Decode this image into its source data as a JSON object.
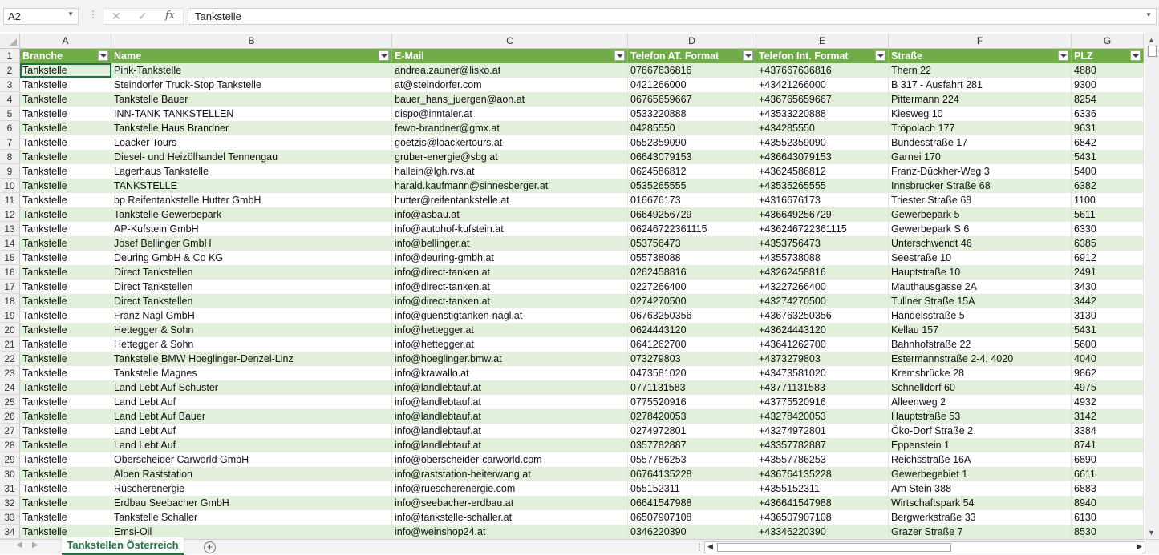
{
  "formula_bar": {
    "name_box": "A2",
    "cancel_icon": "✕",
    "enter_icon": "✓",
    "fx_label": "fx",
    "content": "Tankstelle"
  },
  "columns": [
    "A",
    "B",
    "C",
    "D",
    "E",
    "F",
    "G"
  ],
  "header_row": {
    "row_number": "1",
    "cells": [
      "Branche",
      "Name",
      "E-Mail",
      "Telefon AT. Format",
      "Telefon Int. Format",
      "Straße",
      "PLZ"
    ]
  },
  "rows": [
    {
      "n": "2",
      "cells": [
        "Tankstelle",
        "Pink-Tankstelle",
        "andrea.zauner@lisko.at",
        "07667636816",
        "+437667636816",
        "Thern 22",
        "4880"
      ]
    },
    {
      "n": "3",
      "cells": [
        "Tankstelle",
        "Steindorfer Truck-Stop Tankstelle",
        "at@steindorfer.com",
        "0421266000",
        "+43421266000",
        "B 317 - Ausfahrt 281",
        "9300"
      ]
    },
    {
      "n": "4",
      "cells": [
        "Tankstelle",
        "Tankstelle Bauer",
        "bauer_hans_juergen@aon.at",
        "06765659667",
        "+436765659667",
        "Pittermann 224",
        "8254"
      ]
    },
    {
      "n": "5",
      "cells": [
        "Tankstelle",
        "INN-TANK TANKSTELLEN",
        "dispo@inntaler.at",
        "0533220888",
        "+43533220888",
        "Kiesweg 10",
        "6336"
      ]
    },
    {
      "n": "6",
      "cells": [
        "Tankstelle",
        "Tankstelle Haus Brandner",
        "fewo-brandner@gmx.at",
        "04285550",
        "+434285550",
        "Tröpolach 177",
        "9631"
      ]
    },
    {
      "n": "7",
      "cells": [
        "Tankstelle",
        "Loacker Tours",
        "goetzis@loackertours.at",
        "0552359090",
        "+43552359090",
        "Bundesstraße 17",
        "6842"
      ]
    },
    {
      "n": "8",
      "cells": [
        "Tankstelle",
        "Diesel- und Heizölhandel Tennengau",
        "gruber-energie@sbg.at",
        "06643079153",
        "+436643079153",
        "Garnei 170",
        "5431"
      ]
    },
    {
      "n": "9",
      "cells": [
        "Tankstelle",
        "Lagerhaus Tankstelle",
        "hallein@lgh.rvs.at",
        "0624586812",
        "+43624586812",
        "Franz-Dückher-Weg 3",
        "5400"
      ]
    },
    {
      "n": "10",
      "cells": [
        "Tankstelle",
        "TANKSTELLE",
        "harald.kaufmann@sinnesberger.at",
        "0535265555",
        "+43535265555",
        "Innsbrucker Straße 68",
        "6382"
      ]
    },
    {
      "n": "11",
      "cells": [
        "Tankstelle",
        "bp Reifentankstelle Hutter GmbH",
        "hutter@reifentankstelle.at",
        "016676173",
        "+4316676173",
        "Triester Straße 68",
        "1100"
      ]
    },
    {
      "n": "12",
      "cells": [
        "Tankstelle",
        "Tankstelle Gewerbepark",
        "info@asbau.at",
        "06649256729",
        "+436649256729",
        "Gewerbepark 5",
        "5611"
      ]
    },
    {
      "n": "13",
      "cells": [
        "Tankstelle",
        "AP-Kufstein GmbH",
        "info@autohof-kufstein.at",
        "06246722361115",
        "+436246722361115",
        "Gewerbepark S 6",
        "6330"
      ]
    },
    {
      "n": "14",
      "cells": [
        "Tankstelle",
        "Josef Bellinger GmbH",
        "info@bellinger.at",
        "053756473",
        "+4353756473",
        "Unterschwendt 46",
        "6385"
      ]
    },
    {
      "n": "15",
      "cells": [
        "Tankstelle",
        "Deuring GmbH & Co KG",
        "info@deuring-gmbh.at",
        "055738088",
        "+4355738088",
        "Seestraße 10",
        "6912"
      ]
    },
    {
      "n": "16",
      "cells": [
        "Tankstelle",
        "Direct Tankstellen",
        "info@direct-tanken.at",
        "0262458816",
        "+43262458816",
        "Hauptstraße 10",
        "2491"
      ]
    },
    {
      "n": "17",
      "cells": [
        "Tankstelle",
        "Direct Tankstellen",
        "info@direct-tanken.at",
        "0227266400",
        "+43227266400",
        "Mauthausgasse 2A",
        "3430"
      ]
    },
    {
      "n": "18",
      "cells": [
        "Tankstelle",
        "Direct Tankstellen",
        "info@direct-tanken.at",
        "0274270500",
        "+43274270500",
        "Tullner Straße 15A",
        "3442"
      ]
    },
    {
      "n": "19",
      "cells": [
        "Tankstelle",
        "Franz Nagl GmbH",
        "info@guenstigtanken-nagl.at",
        "06763250356",
        "+436763250356",
        "Handelsstraße 5",
        "3130"
      ]
    },
    {
      "n": "20",
      "cells": [
        "Tankstelle",
        "Hettegger & Sohn",
        "info@hettegger.at",
        "0624443120",
        "+43624443120",
        "Kellau 157",
        "5431"
      ]
    },
    {
      "n": "21",
      "cells": [
        "Tankstelle",
        "Hettegger & Sohn",
        "info@hettegger.at",
        "0641262700",
        "+43641262700",
        "Bahnhofstraße 22",
        "5600"
      ]
    },
    {
      "n": "22",
      "cells": [
        "Tankstelle",
        "Tankstelle BMW Hoeglinger-Denzel-Linz",
        "info@hoeglinger.bmw.at",
        "073279803",
        "+4373279803",
        "Estermannstraße 2-4,  4020",
        "4040"
      ]
    },
    {
      "n": "23",
      "cells": [
        "Tankstelle",
        "Tankstelle Magnes",
        "info@krawallo.at",
        "0473581020",
        "+43473581020",
        "Kremsbrücke 28",
        "9862"
      ]
    },
    {
      "n": "24",
      "cells": [
        "Tankstelle",
        "Land Lebt Auf Schuster",
        "info@landlebtauf.at",
        "0771131583",
        "+43771131583",
        "Schnelldorf 60",
        "4975"
      ]
    },
    {
      "n": "25",
      "cells": [
        "Tankstelle",
        "Land Lebt Auf",
        "info@landlebtauf.at",
        "0775520916",
        "+43775520916",
        "Alleenweg 2",
        "4932"
      ]
    },
    {
      "n": "26",
      "cells": [
        "Tankstelle",
        "Land Lebt Auf Bauer",
        "info@landlebtauf.at",
        "0278420053",
        "+43278420053",
        "Hauptstraße 53",
        "3142"
      ]
    },
    {
      "n": "27",
      "cells": [
        "Tankstelle",
        "Land Lebt Auf",
        "info@landlebtauf.at",
        "0274972801",
        "+43274972801",
        "Öko-Dorf Straße 2",
        "3384"
      ]
    },
    {
      "n": "28",
      "cells": [
        "Tankstelle",
        "Land Lebt Auf",
        "info@landlebtauf.at",
        "0357782887",
        "+43357782887",
        "Eppenstein 1",
        "8741"
      ]
    },
    {
      "n": "29",
      "cells": [
        "Tankstelle",
        "Oberscheider Carworld GmbH",
        "info@oberscheider-carworld.com",
        "0557786253",
        "+43557786253",
        "Reichsstraße 16A",
        "6890"
      ]
    },
    {
      "n": "30",
      "cells": [
        "Tankstelle",
        "Alpen Raststation",
        "info@raststation-heiterwang.at",
        "06764135228",
        "+436764135228",
        "Gewerbegebiet 1",
        "6611"
      ]
    },
    {
      "n": "31",
      "cells": [
        "Tankstelle",
        "Rüscherenergie",
        "info@ruescherenergie.com",
        "055152311",
        "+4355152311",
        "Am Stein 388",
        "6883"
      ]
    },
    {
      "n": "32",
      "cells": [
        "Tankstelle",
        "Erdbau Seebacher GmbH",
        "info@seebacher-erdbau.at",
        "06641547988",
        "+436641547988",
        "Wirtschaftspark 54",
        "8940"
      ]
    },
    {
      "n": "33",
      "cells": [
        "Tankstelle",
        "Tankstelle Schaller",
        "info@tankstelle-schaller.at",
        "06507907108",
        "+436507907108",
        "Bergwerkstraße 33",
        "6130"
      ]
    },
    {
      "n": "34",
      "cells": [
        "Tankstelle",
        "Emsi-Oil",
        "info@weinshop24.at",
        "0346220390",
        "+43346220390",
        "Grazer Straße 7",
        "8530"
      ]
    }
  ],
  "sheet_tabs": [
    {
      "label": "Tankstellen Österreich",
      "active": true
    }
  ],
  "add_sheet_label": "+",
  "colors": {
    "header_fill": "#70ad47",
    "band_fill": "#e2efda",
    "accent": "#217346"
  }
}
